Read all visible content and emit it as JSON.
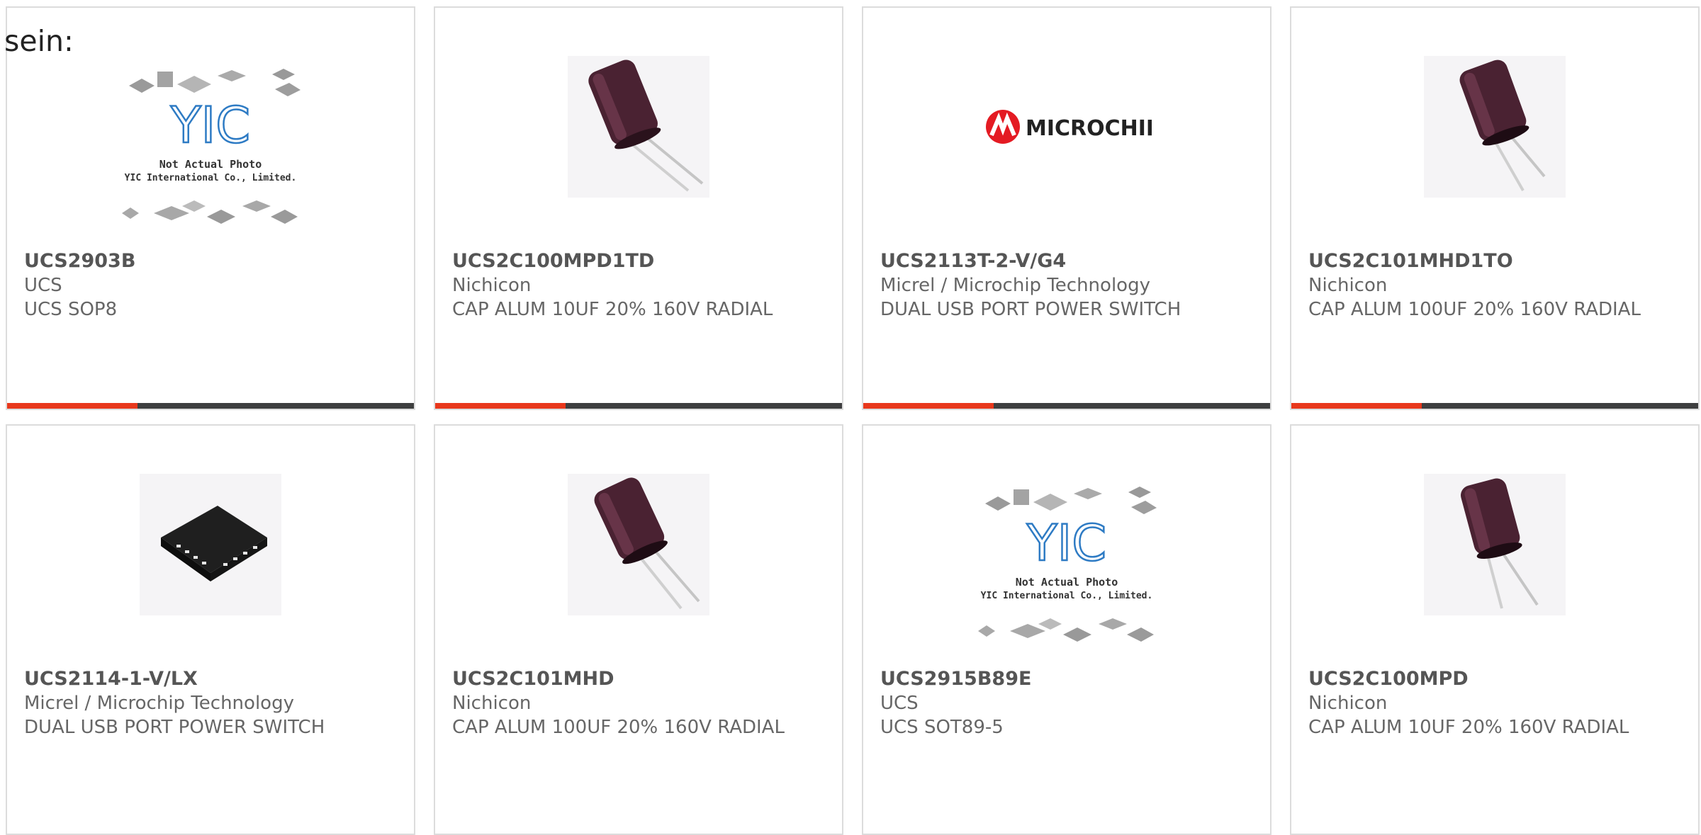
{
  "intro_text": "sein:",
  "products": [
    {
      "part": "UCS2903B",
      "manufacturer": "UCS",
      "description": "UCS SOP8",
      "image": "yic-placeholder"
    },
    {
      "part": "UCS2C100MPD1TD",
      "manufacturer": "Nichicon",
      "description": "CAP ALUM 10UF 20% 160V RADIAL",
      "image": "capacitor"
    },
    {
      "part": "UCS2113T-2-V/G4",
      "manufacturer": "Micrel / Microchip Technology",
      "description": "DUAL USB PORT POWER SWITCH",
      "image": "microchip-logo"
    },
    {
      "part": "UCS2C101MHD1TO",
      "manufacturer": "Nichicon",
      "description": "CAP ALUM 100UF 20% 160V RADIAL",
      "image": "capacitor"
    },
    {
      "part": "UCS2114-1-V/LX",
      "manufacturer": "Micrel / Microchip Technology",
      "description": "DUAL USB PORT POWER SWITCH",
      "image": "qfn-chip"
    },
    {
      "part": "UCS2C101MHD",
      "manufacturer": "Nichicon",
      "description": "CAP ALUM 100UF 20% 160V RADIAL",
      "image": "capacitor"
    },
    {
      "part": "UCS2915B89E",
      "manufacturer": "UCS",
      "description": "UCS SOT89-5",
      "image": "yic-placeholder"
    },
    {
      "part": "UCS2C100MPD",
      "manufacturer": "Nichicon",
      "description": "CAP ALUM 10UF 20% 160V RADIAL",
      "image": "capacitor"
    }
  ],
  "placeholder": {
    "line1": "Not Actual Photo",
    "line2": "YIC International Co., Limited.",
    "logo": "YIC"
  },
  "microchip_logo_text": "MICROCHIP",
  "colors": {
    "accent": "#e8381c",
    "bar": "#3e3f40",
    "border": "#dcdcdc"
  }
}
